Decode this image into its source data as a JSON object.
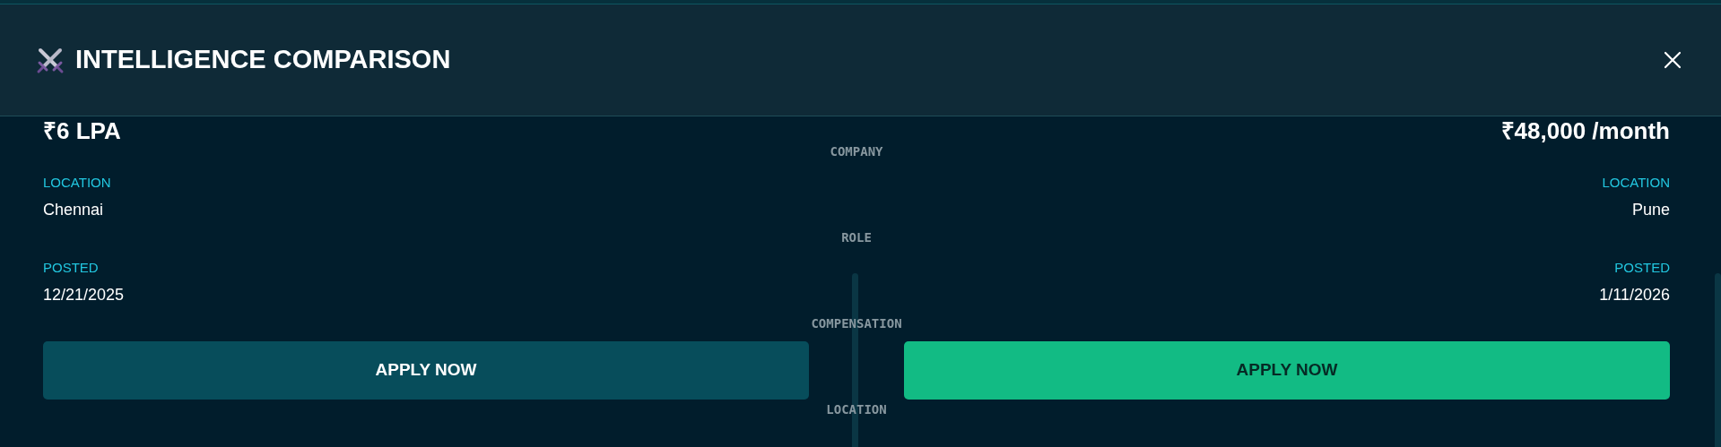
{
  "dialog": {
    "title": "INTELLIGENCE COMPARISON"
  },
  "offers": [
    {
      "salary": "₹6 LPA",
      "fields": [
        {
          "label": "LOCATION",
          "value": "Chennai"
        },
        {
          "label": "POSTED",
          "value": "12/21/2025"
        }
      ],
      "apply_button": {
        "label": "APPLY NOW",
        "kind": "muted"
      }
    },
    {
      "salary": "₹48,000 /month",
      "fields": [
        {
          "label": "LOCATION",
          "value": "Pune"
        },
        {
          "label": "POSTED",
          "value": "1/11/2026"
        }
      ],
      "apply_button": {
        "label": "APPLY NOW",
        "kind": "accent"
      }
    }
  ],
  "axis_labels": [
    "COMPANY",
    "ROLE",
    "COMPENSATION",
    "LOCATION"
  ]
}
